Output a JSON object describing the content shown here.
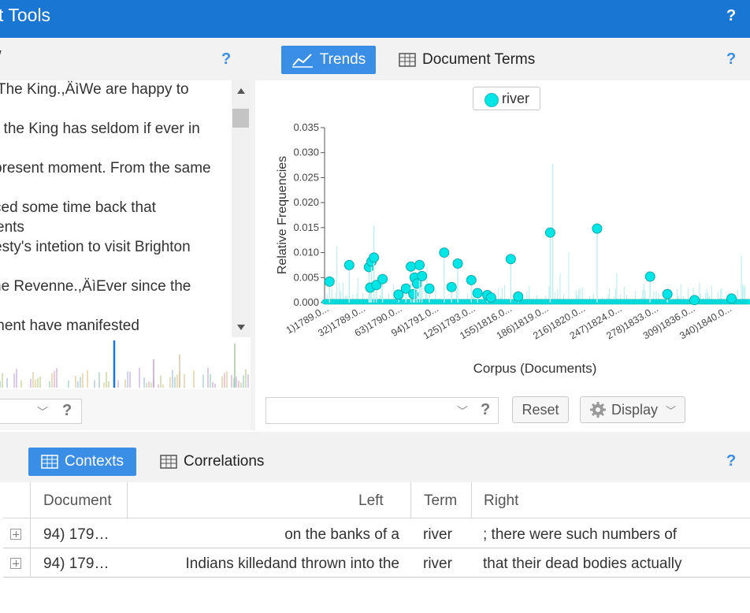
{
  "app": {
    "title": "t Tools",
    "help": "?"
  },
  "reader": {
    "tab_fragment": "/",
    "lines": [
      "The King.,ÄìWe are happy to",
      "t the King has seldom if ever in",
      "present moment. From the same",
      "ced some time back that",
      "ents",
      "esty's intetion to visit Brighton",
      "ne Revenne.,ÄìEver since the",
      "ment have manifested"
    ],
    "help": "?"
  },
  "trends_panel": {
    "tabs": [
      {
        "label": "Trends",
        "active": true,
        "icon": "line-chart-icon"
      },
      {
        "label": "Document Terms",
        "active": false,
        "icon": "table-icon"
      }
    ],
    "help": "?",
    "legend": "river",
    "reset_label": "Reset",
    "display_label": "Display",
    "help2": "?"
  },
  "chart_data": {
    "type": "line",
    "title": "",
    "ylabel": "Relative Frequencies",
    "xlabel": "Corpus (Documents)",
    "ylim": [
      0,
      0.035
    ],
    "yticks": [
      "0.035",
      "0.030",
      "0.025",
      "0.020",
      "0.015",
      "0.010",
      "0.005",
      "0.000"
    ],
    "xticks": [
      "1)1789.0...",
      "32)1789.0...",
      "63)1790.0...",
      "94)1791.0...",
      "125)1793.0...",
      "155)1816.0...",
      "186)1819.0...",
      "216)1820.0...",
      "247)1824.0...",
      "278)1833.0...",
      "309)1836.0...",
      "340)1840.0..."
    ],
    "series": [
      {
        "name": "river",
        "color": "#00e5e5",
        "points": [
          [
            4,
            0.0042
          ],
          [
            20,
            0.0075
          ],
          [
            36,
            0.0071
          ],
          [
            38,
            0.0082
          ],
          [
            40,
            0.009
          ],
          [
            37,
            0.003
          ],
          [
            42,
            0.0035
          ],
          [
            47,
            0.0047
          ],
          [
            60,
            0.0016
          ],
          [
            66,
            0.0028
          ],
          [
            70,
            0.0072
          ],
          [
            72,
            0.0017
          ],
          [
            73,
            0.005
          ],
          [
            75,
            0.0038
          ],
          [
            77,
            0.0075
          ],
          [
            79,
            0.0053
          ],
          [
            85,
            0.0028
          ],
          [
            97,
            0.01
          ],
          [
            103,
            0.0031
          ],
          [
            108,
            0.0078
          ],
          [
            119,
            0.0045
          ],
          [
            124,
            0.0019
          ],
          [
            132,
            0.0015
          ],
          [
            135,
            0.001
          ],
          [
            151,
            0.0087
          ],
          [
            157,
            0.0012
          ],
          [
            183,
            0.014
          ],
          [
            221,
            0.0148
          ],
          [
            264,
            0.0052
          ],
          [
            278,
            0.0017
          ],
          [
            300,
            0.0005
          ],
          [
            330,
            0.0008
          ]
        ]
      }
    ]
  },
  "bottom_panel": {
    "tabs": [
      {
        "label": "Contexts",
        "active": true,
        "icon": "table-icon"
      },
      {
        "label": "Correlations",
        "active": false,
        "icon": "table-icon"
      }
    ],
    "help": "?",
    "columns": [
      "Document",
      "Left",
      "Term",
      "Right"
    ],
    "rows": [
      {
        "document": "94) 179…",
        "left": "on the banks of a",
        "term": "river",
        "right": "; there were such numbers of"
      },
      {
        "document": "94) 179…",
        "left": "Indians killedand thrown into the",
        "term": "river",
        "right": "that their dead bodies actually"
      }
    ]
  },
  "colors": {
    "brand": "#1976d2",
    "accent": "#3a8ee6",
    "series": "#00e5e5"
  }
}
